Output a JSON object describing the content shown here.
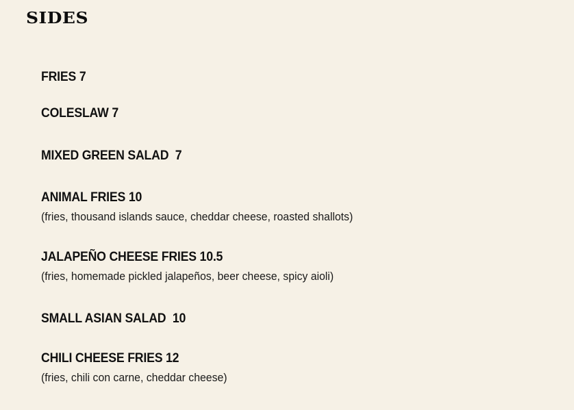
{
  "section": {
    "title": "Sides"
  },
  "items": [
    {
      "name": "FRIES 7"
    },
    {
      "name": "COLESLAW 7"
    },
    {
      "name": "MIXED GREEN SALAD  7"
    },
    {
      "name": "ANIMAL FRIES 10",
      "description": "(fries, thousand islands sauce, cheddar cheese, roasted shallots)"
    },
    {
      "name": "JALAPEÑO CHEESE FRIES 10.5",
      "description": "(fries, homemade pickled jalapeños, beer cheese, spicy aioli)"
    },
    {
      "name": "SMALL ASIAN SALAD  10"
    },
    {
      "name": "CHILI CHEESE FRIES 12",
      "description": "(fries, chili con carne, cheddar cheese)"
    }
  ]
}
